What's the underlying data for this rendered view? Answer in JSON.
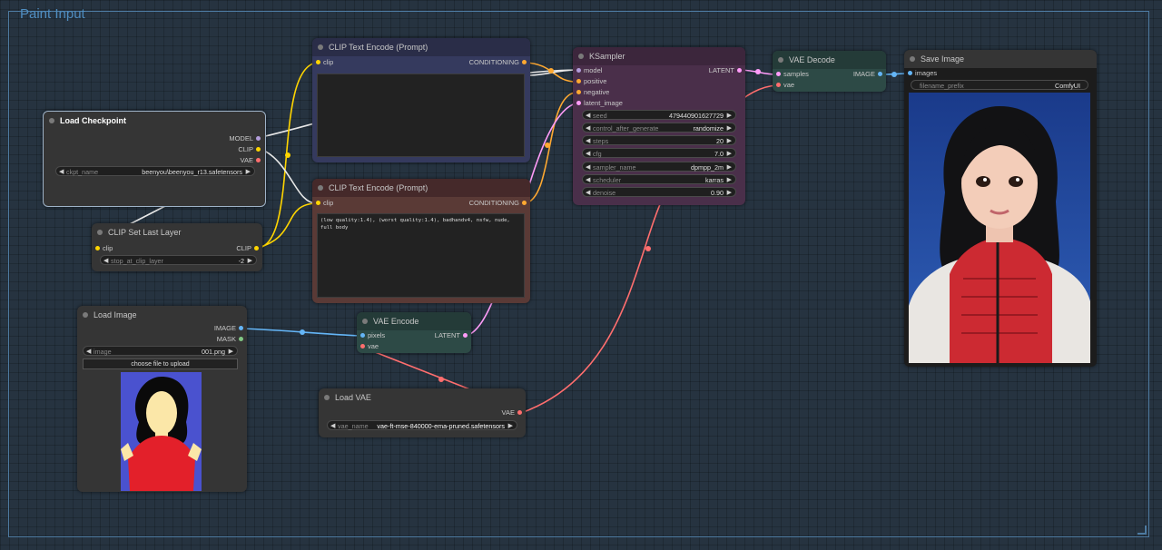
{
  "group": {
    "title": "Paint Input"
  },
  "colors": {
    "model": "#b39ddb",
    "clip": "#ffd500",
    "vae": "#ff6e6e",
    "conditioning": "#ffa931",
    "latent": "#ff9cf9",
    "image": "#64b5f6"
  },
  "load_checkpoint": {
    "title": "Load Checkpoint",
    "outputs": [
      "MODEL",
      "CLIP",
      "VAE"
    ],
    "ckpt_name_label": "ckpt_name",
    "ckpt_name_value": "beenyou\\beenyou_r13.safetensors"
  },
  "clip_set_last_layer": {
    "title": "CLIP Set Last Layer",
    "input": "clip",
    "output": "CLIP",
    "stop_label": "stop_at_clip_layer",
    "stop_value": "-2"
  },
  "clip_pos": {
    "title": "CLIP Text Encode (Prompt)",
    "input": "clip",
    "output": "CONDITIONING",
    "text": ""
  },
  "clip_neg": {
    "title": "CLIP Text Encode (Prompt)",
    "input": "clip",
    "output": "CONDITIONING",
    "text": "(low quality:1.4), (worst quality:1.4), badhandv4, nsfw, nude, full body"
  },
  "ksampler": {
    "title": "KSampler",
    "inputs": [
      "model",
      "positive",
      "negative",
      "latent_image"
    ],
    "output": "LATENT",
    "widgets": [
      {
        "label": "seed",
        "value": "479440901627729"
      },
      {
        "label": "control_after_generate",
        "value": "randomize"
      },
      {
        "label": "steps",
        "value": "20"
      },
      {
        "label": "cfg",
        "value": "7.0"
      },
      {
        "label": "sampler_name",
        "value": "dpmpp_2m"
      },
      {
        "label": "scheduler",
        "value": "karras"
      },
      {
        "label": "denoise",
        "value": "0.90"
      }
    ]
  },
  "vae_decode": {
    "title": "VAE Decode",
    "inputs": [
      "samples",
      "vae"
    ],
    "output": "IMAGE"
  },
  "save_image": {
    "title": "Save Image",
    "input": "images",
    "prefix_label": "filename_prefix",
    "prefix_value": "ComfyUI"
  },
  "load_image": {
    "title": "Load Image",
    "outputs": [
      "IMAGE",
      "MASK"
    ],
    "image_label": "image",
    "image_value": "001.png",
    "upload_label": "choose file to upload"
  },
  "vae_encode": {
    "title": "VAE Encode",
    "inputs": [
      "pixels",
      "vae"
    ],
    "output": "LATENT"
  },
  "load_vae": {
    "title": "Load VAE",
    "output": "VAE",
    "vae_name_label": "vae_name",
    "vae_name_value": "vae-ft-mse-840000-ema-pruned.safetensors"
  }
}
